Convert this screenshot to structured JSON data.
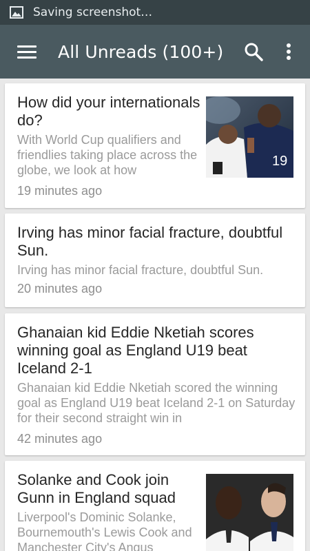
{
  "status_bar": {
    "icon": "image-icon",
    "text": "Saving screenshot…"
  },
  "app_bar": {
    "title": "All Unreads (100+)",
    "icons": [
      "menu-icon",
      "search-icon",
      "more-vertical-icon"
    ],
    "color": "#4a5a60"
  },
  "articles": [
    {
      "headline": "How did your internationals do?",
      "summary": "With World Cup qualifiers and friendlies taking place across the globe, we look at how",
      "time": "19 minutes ago",
      "has_thumbnail": true
    },
    {
      "headline": "Irving has minor facial fracture, doubtful Sun.",
      "summary": "Irving has minor facial fracture, doubtful Sun.",
      "time": "20 minutes ago",
      "has_thumbnail": false
    },
    {
      "headline": "Ghanaian kid Eddie Nketiah scores winning goal as England U19 beat Iceland 2-1",
      "summary": "Ghanaian kid Eddie Nketiah scored the winning goal as England U19 beat Iceland 2-1 on Saturday for their second straight win in",
      "time": "42 minutes ago",
      "has_thumbnail": false
    },
    {
      "headline": "Solanke and Cook join Gunn in England squad",
      "summary": "Liverpool's Dominic Solanke, Bournemouth's Lewis Cook and Manchester City's Angus",
      "time": "",
      "has_thumbnail": true
    }
  ]
}
